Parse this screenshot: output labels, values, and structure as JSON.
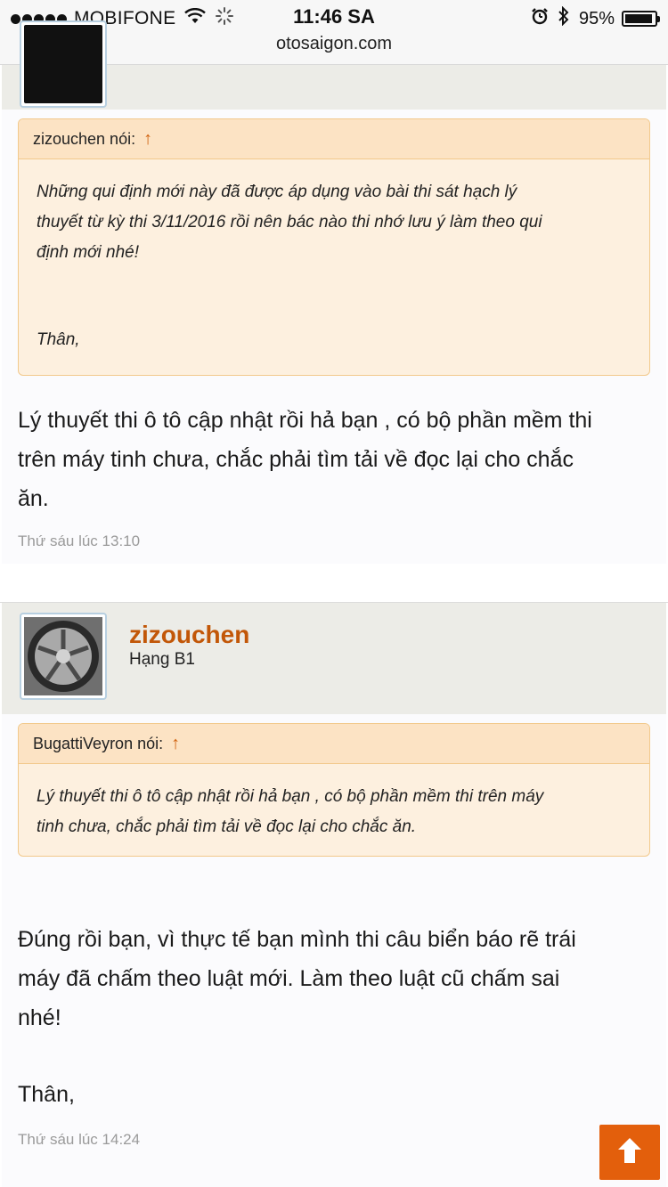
{
  "status_bar": {
    "carrier": "MOBIFONE",
    "time": "11:46 SA",
    "battery": "95%",
    "battery_level": 0.95,
    "url": "otosaigon.com"
  },
  "post1": {
    "quote": {
      "author_label": "zizouchen nói:",
      "arrow": "↑",
      "line1": "Những qui định mới này đã được áp dụng vào bài thi sát hạch lý",
      "line2": "thuyết từ kỳ thi 3/11/2016 rồi nên bác nào thi nhớ lưu ý làm theo qui",
      "line3": "định mới nhé!",
      "line4": "Thân,"
    },
    "message_line1": "Lý thuyết thi ô tô cập nhật rồi hả bạn , có bộ phần mềm thi",
    "message_line2": "trên máy tinh chưa, chắc phải tìm tải về đọc lại cho chắc",
    "message_line3": "ăn.",
    "date": "Thứ sáu lúc 13:10"
  },
  "post2": {
    "author": "zizouchen",
    "rank": "Hạng B1",
    "quote": {
      "author_label": "BugattiVeyron nói:",
      "arrow": "↑",
      "line1": "Lý thuyết thi ô tô cập nhật rồi hả bạn , có bộ phần mềm thi trên máy",
      "line2": "tinh chưa, chắc phải tìm tải về đọc lại cho chắc ăn."
    },
    "message_line1": "Đúng rồi bạn, vì thực tế bạn mình thi câu biển báo rẽ trái",
    "message_line2": "máy đã chấm theo luật mới. Làm theo luật cũ chấm sai",
    "message_line3": "nhé!",
    "message_line4": "Thân,",
    "date": "Thứ sáu lúc 14:24"
  },
  "colors": {
    "accent": "#e35f0c",
    "author_name": "#c25708",
    "quote_bg": "#fdf0df",
    "quote_head": "#fce3c4"
  },
  "icons": {
    "scroll_top": "arrow-up-icon",
    "wifi": "wifi-icon",
    "bluetooth": "bluetooth-icon",
    "alarm": "alarm-icon"
  }
}
